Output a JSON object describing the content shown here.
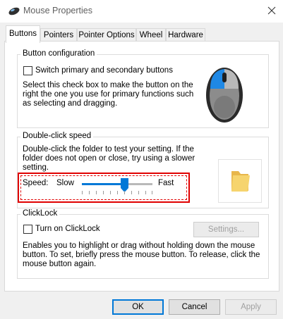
{
  "window": {
    "title": "Mouse Properties"
  },
  "tabs": [
    "Buttons",
    "Pointers",
    "Pointer Options",
    "Wheel",
    "Hardware"
  ],
  "button_config": {
    "title": "Button configuration",
    "checkbox_label": "Switch primary and secondary buttons",
    "description": [
      "Select this check box to make the button on the",
      "right the one you use for primary functions such",
      "as selecting and dragging."
    ]
  },
  "double_click": {
    "title": "Double-click speed",
    "description": [
      "Double-click the folder to test your setting. If the",
      "folder does not open or close, try using a slower",
      "setting."
    ],
    "speed_label": "Speed:",
    "slow_label": "Slow",
    "fast_label": "Fast",
    "speed_value_fraction": 0.6
  },
  "clicklock": {
    "title": "ClickLock",
    "checkbox_label": "Turn on ClickLock",
    "settings_button": "Settings...",
    "description": [
      "Enables you to highlight or drag without holding down the mouse",
      "button. To set, briefly press the mouse button. To release, click the",
      "mouse button again."
    ]
  },
  "footer": {
    "ok": "OK",
    "cancel": "Cancel",
    "apply": "Apply"
  },
  "colors": {
    "accent": "#0078d7",
    "highlight_box": "#e00000"
  }
}
